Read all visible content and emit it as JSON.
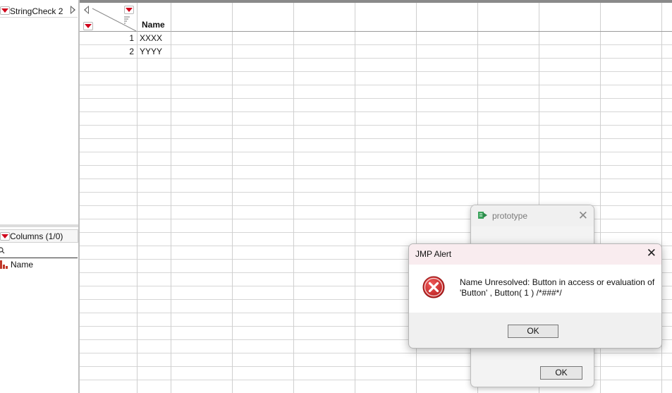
{
  "table": {
    "title": "StringCheck 2"
  },
  "columns_panel": {
    "header": "Columns (1/0)",
    "items": [
      "Name"
    ]
  },
  "grid": {
    "column_header": "Name",
    "rows": [
      {
        "num": "1",
        "value": "XXXX"
      },
      {
        "num": "2",
        "value": "YYYY"
      }
    ]
  },
  "prototype_window": {
    "title": "prototype",
    "ok_label": "OK"
  },
  "alert": {
    "title": "JMP Alert",
    "message": "Name Unresolved: Button in access or evaluation of 'Button' , Button( 1 ) /*###*/",
    "ok_label": "OK"
  },
  "colors": {
    "accent_red": "#d0021b",
    "alert_title_bg": "#f9ecef",
    "error_icon": "#c62828"
  },
  "icons": [
    "dropdown-triangle-icon",
    "search-icon",
    "column-bar-icon",
    "close-icon",
    "error-icon",
    "script-icon"
  ]
}
